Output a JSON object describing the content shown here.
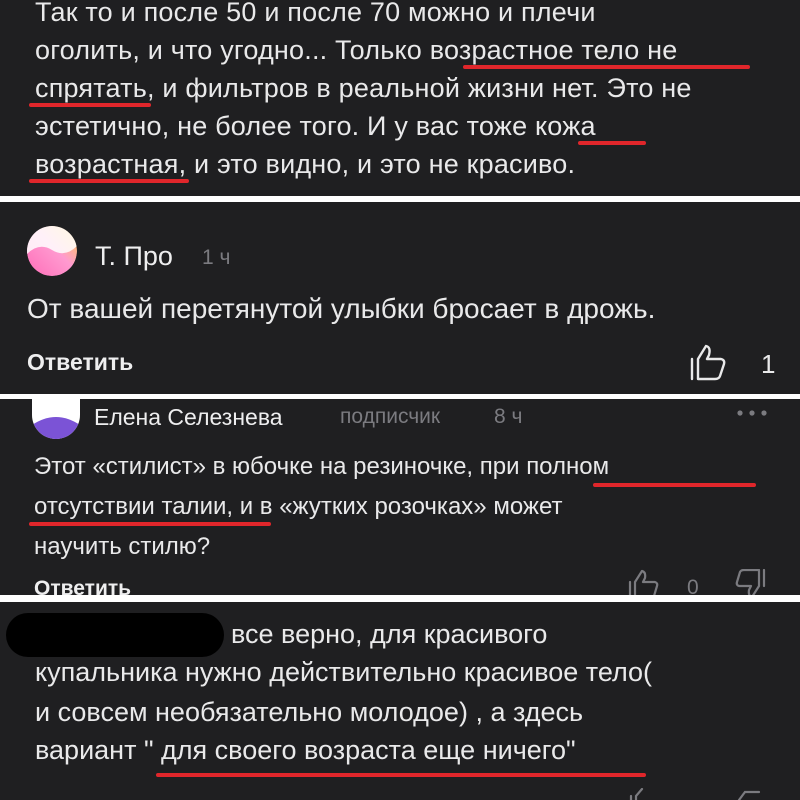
{
  "comment_1": {
    "lines": [
      "Так то и после 50 и после 70 можно и плечи",
      "оголить, и что угодно... Только возрастное тело не",
      "спрятать, и фильтров в реальной жизни нет. Это не",
      "эстетично, не более того. И у вас тоже кожа",
      "возрастная, и это видно, и это не красиво."
    ]
  },
  "comment_2": {
    "author": "Т. Про",
    "time": "1 ч",
    "lines": [
      "От вашей перетянутой улыбки бросает в дрожь."
    ],
    "reply_label": "Ответить",
    "like_count": "1"
  },
  "comment_3": {
    "author": "Елена Селезнева",
    "badge": "подписчик",
    "time": "8 ч",
    "lines": [
      "Этот «стилист» в юбочке на резиночке, при полном",
      "отсутствии талии, и в «жутких розочках» может",
      "научить стилю?"
    ],
    "reply_label": "Ответить",
    "like_count": "0"
  },
  "comment_4": {
    "lines": [
      "все верно, для красивого",
      "купальника нужно действительно красивое тело(",
      "и совсем необязательно молодое) , а здесь",
      "вариант \" для своего возраста еще ничего\""
    ]
  },
  "colors": {
    "panel_bg": "#1f1f21",
    "text": "#e9e9ea",
    "meta": "#7b7b80",
    "underline": "#e0262b",
    "separator": "#ffffff"
  },
  "icons": [
    "like-icon",
    "dislike-icon",
    "more-options-icon"
  ]
}
